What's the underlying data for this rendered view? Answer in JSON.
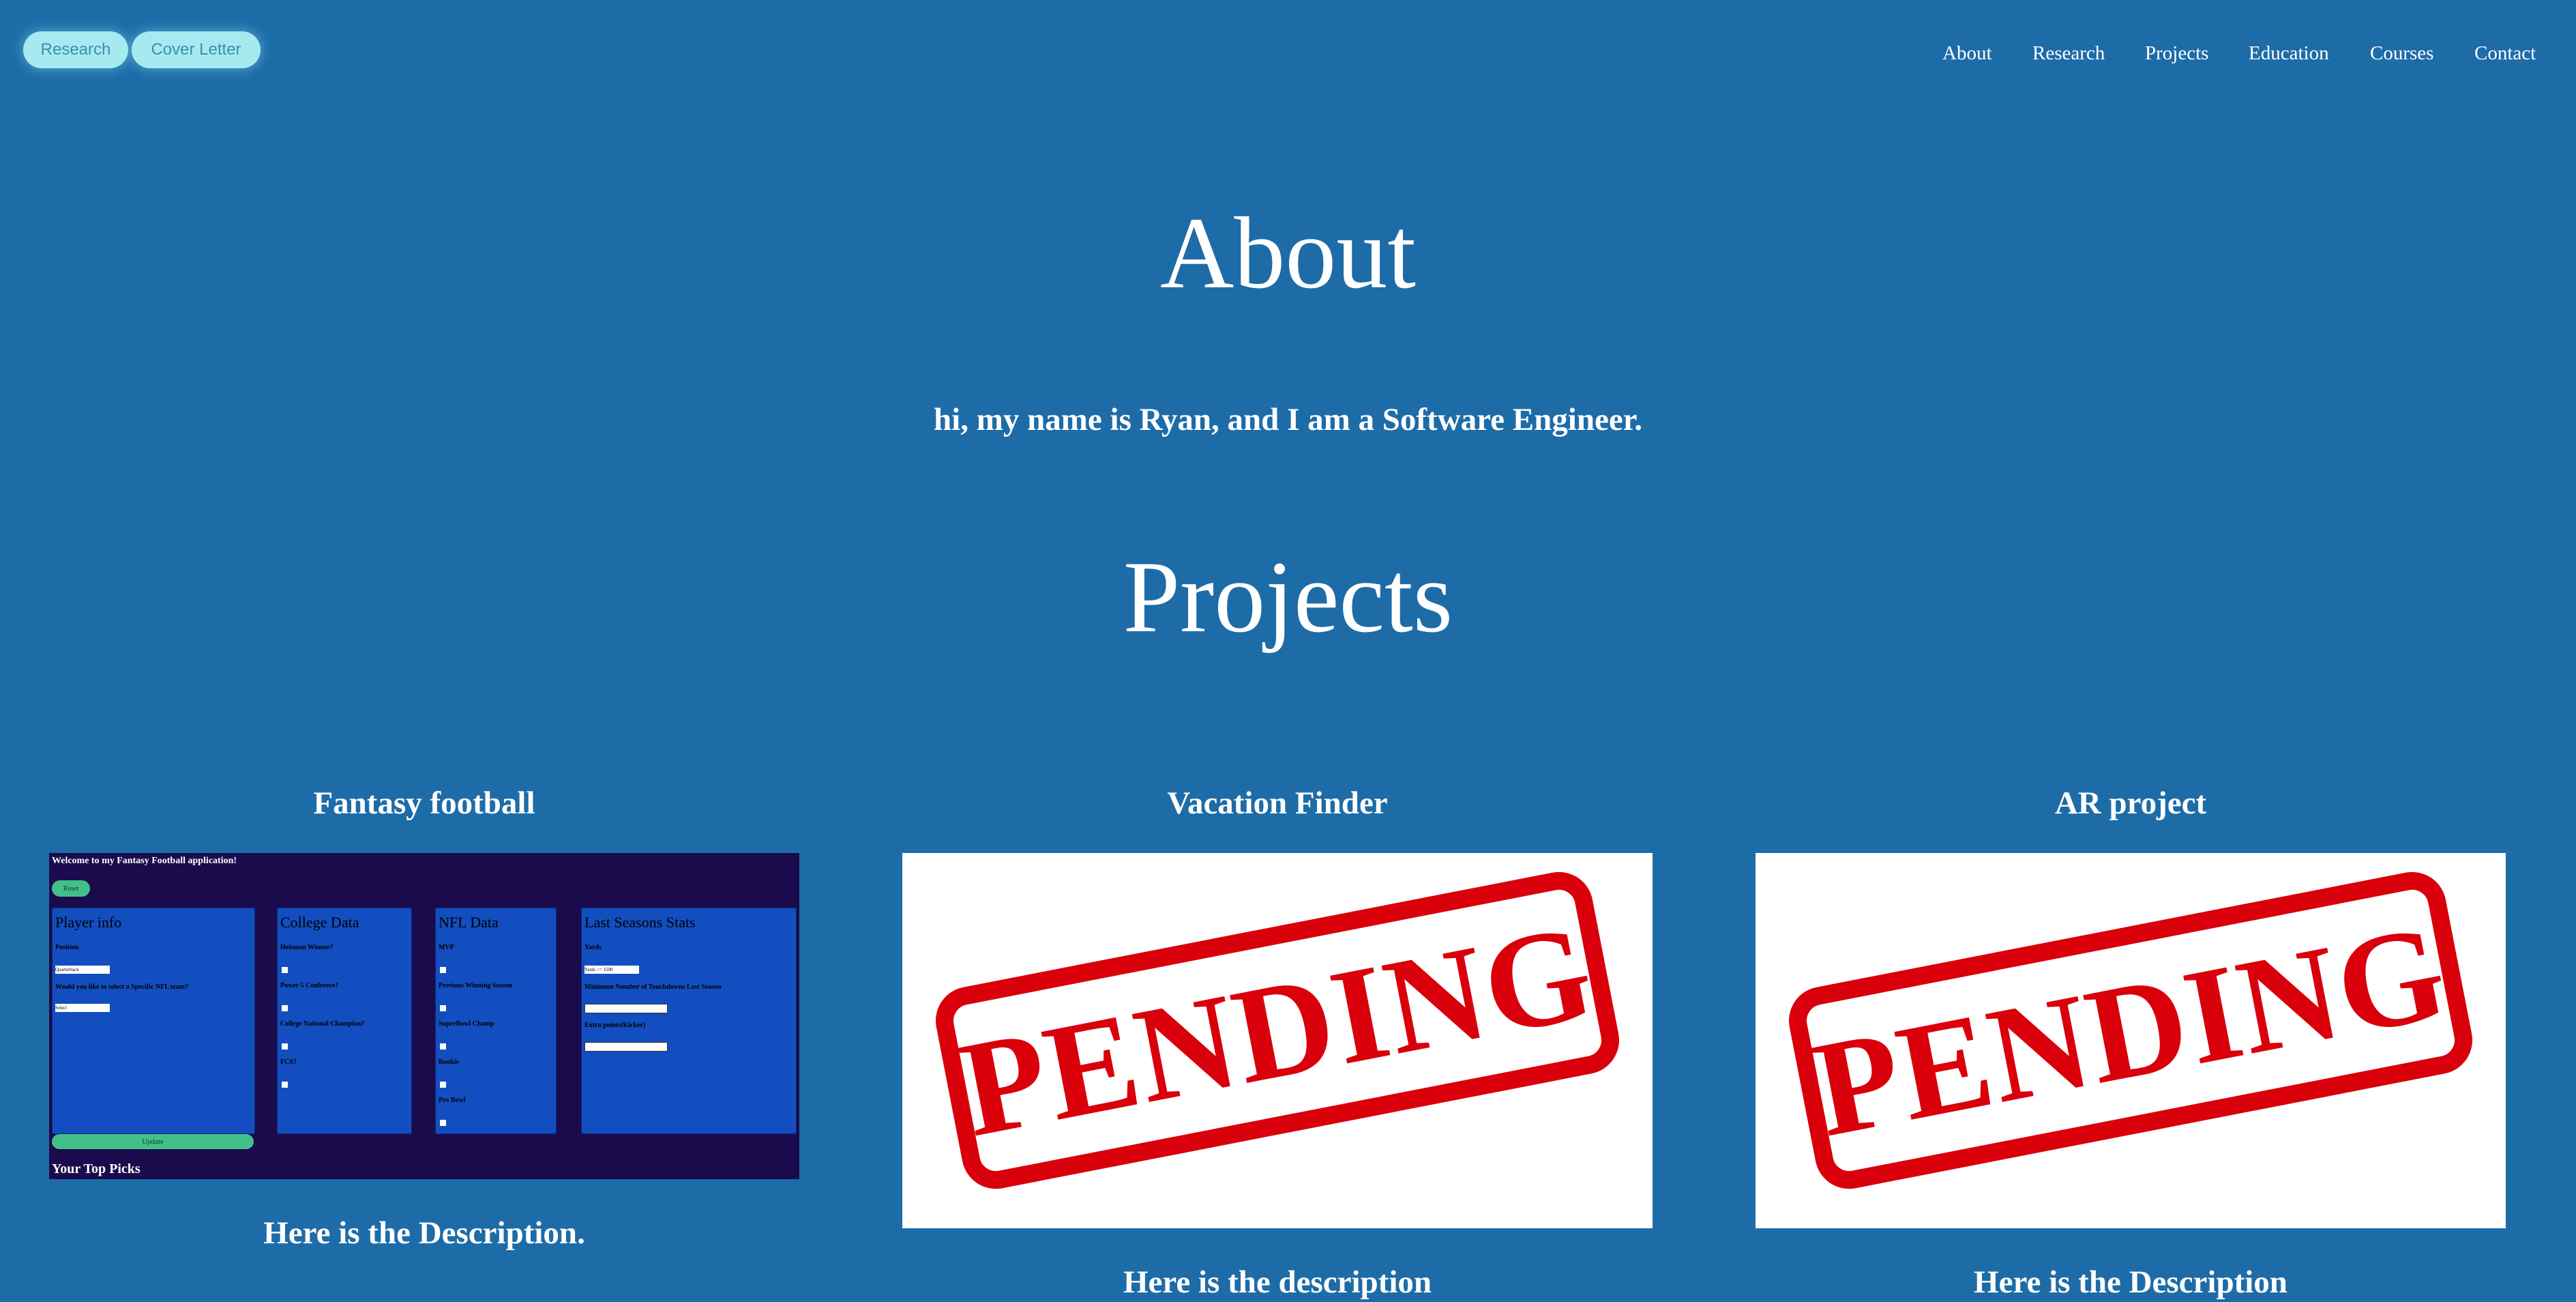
{
  "header": {
    "buttons": [
      "Research",
      "Cover Letter"
    ],
    "nav": [
      "About",
      "Research",
      "Projects",
      "Education",
      "Courses",
      "Contact"
    ]
  },
  "about": {
    "title": "About",
    "intro": "hi, my name is Ryan, and I am a Software Engineer."
  },
  "projects": {
    "title": "Projects",
    "items": [
      {
        "title": "Fantasy football",
        "description": "Here is the Description.",
        "app": {
          "welcome": "Welcome to my Fantasy Football application!",
          "reset": "Reset",
          "panels": [
            {
              "title": "Player info",
              "labels": [
                "Position",
                "Would you like to select a Specific NFL team?"
              ],
              "select": "Quarterback",
              "select2": "Select"
            },
            {
              "title": "College Data",
              "labels": [
                "Heisman Winner?",
                "Power 5 Conferece?",
                "College National Champion?",
                "FCS?"
              ]
            },
            {
              "title": "NFL Data",
              "labels": [
                "MVP",
                "Previous Winning Season",
                "SuperBowl Champ",
                "Rookie",
                "Pro Bowl"
              ]
            },
            {
              "title": "Last Seasons Stats",
              "labels": [
                "Yards",
                "Minimum Number of Touchdowns Last Season",
                "Extra points(Kicker)"
              ],
              "select": "Yards >= 1500"
            }
          ],
          "update": "Update",
          "picks": "Your Top Picks"
        }
      },
      {
        "title": "Vacation Finder",
        "description": "Here is the description",
        "image_text": "PENDING"
      },
      {
        "title": "AR project",
        "description": "Here is the Description",
        "image_text": "PENDING"
      }
    ]
  }
}
